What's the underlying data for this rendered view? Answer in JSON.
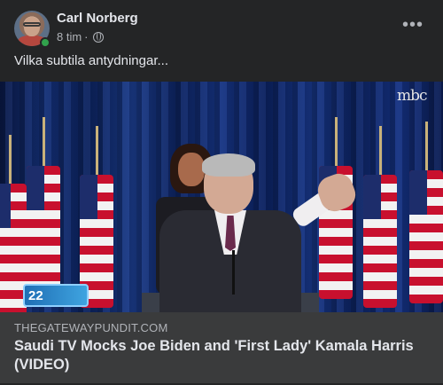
{
  "post": {
    "author": "Carl Norberg",
    "time": "8 tim",
    "separator": "·",
    "privacy_icon": "globe-icon",
    "more_label": "•••",
    "text": "Vilka subtila antydningar..."
  },
  "media": {
    "channel_logo": "mbc",
    "badge_text": "22"
  },
  "link_preview": {
    "domain": "THEGATEWAYPUNDIT.COM",
    "title": "Saudi TV Mocks Joe Biden and 'First Lady' Kamala Harris (VIDEO)"
  },
  "colors": {
    "background": "#242526",
    "preview_bg": "#3a3b3c",
    "online": "#31a24c"
  }
}
